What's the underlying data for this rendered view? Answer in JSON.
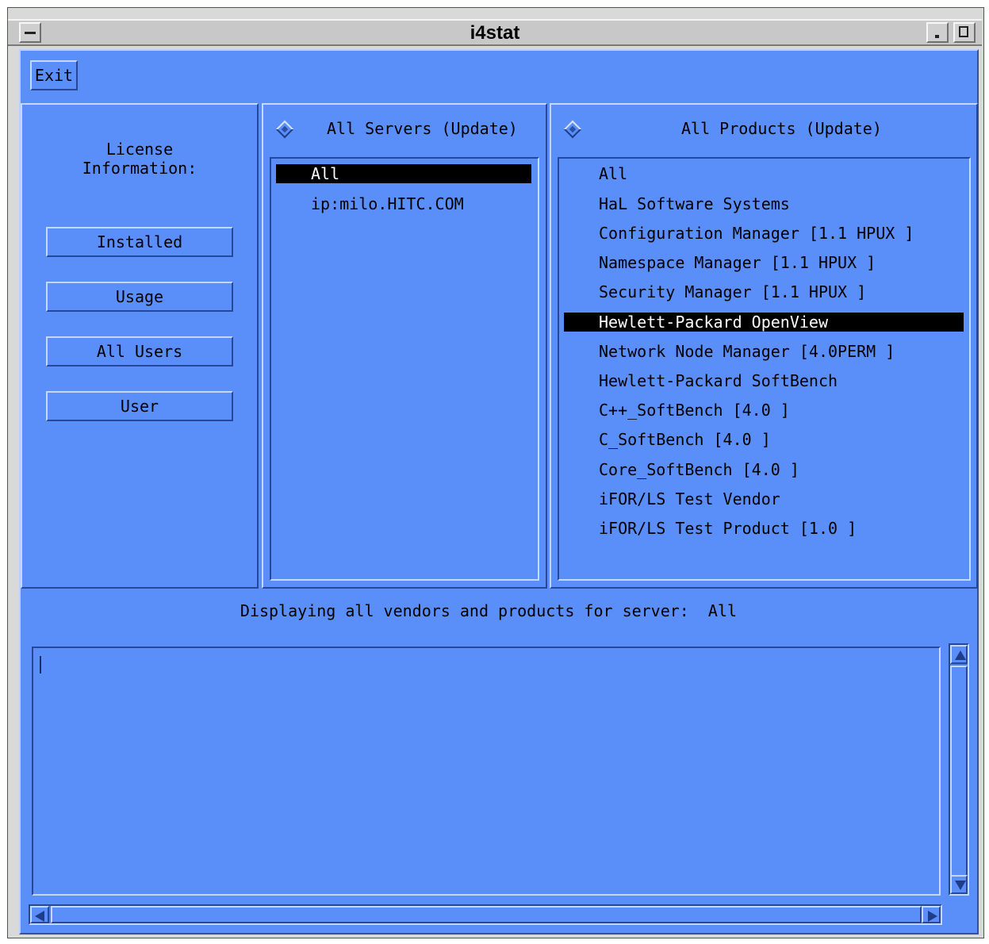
{
  "window": {
    "title": "i4stat"
  },
  "toolbar": {
    "exit_label": "Exit"
  },
  "license": {
    "label": "License\nInformation:",
    "buttons": [
      "Installed",
      "Usage",
      "All Users",
      "User"
    ]
  },
  "servers": {
    "header": "All Servers (Update)",
    "items": [
      "All",
      "ip:milo.HITC.COM"
    ],
    "selected_index": 0
  },
  "products": {
    "header": "All Products (Update)",
    "items": [
      "All",
      "HaL Software Systems",
      "Configuration Manager [1.1 HPUX ]",
      "Namespace Manager [1.1 HPUX ]",
      "Security Manager [1.1 HPUX ]",
      "Hewlett-Packard OpenView",
      "Network Node Manager [4.0PERM ]",
      "Hewlett-Packard SoftBench",
      "C++_SoftBench [4.0 ]",
      "C_SoftBench [4.0 ]",
      "Core_SoftBench [4.0 ]",
      "iFOR/LS Test Vendor",
      "iFOR/LS Test Product [1.0 ]"
    ],
    "selected_index": 5
  },
  "status": {
    "text": "Displaying all vendors and products for server:  All"
  },
  "icons": [
    "window-menu-icon",
    "minimize-icon",
    "maximize-icon",
    "diamond-radio-icon",
    "arrow-up-icon",
    "arrow-down-icon",
    "arrow-left-icon",
    "arrow-right-icon",
    "text-cursor-icon"
  ],
  "colors": {
    "background": "#5a8ef8",
    "selection": "#000000",
    "selection_text": "#ffffff"
  }
}
